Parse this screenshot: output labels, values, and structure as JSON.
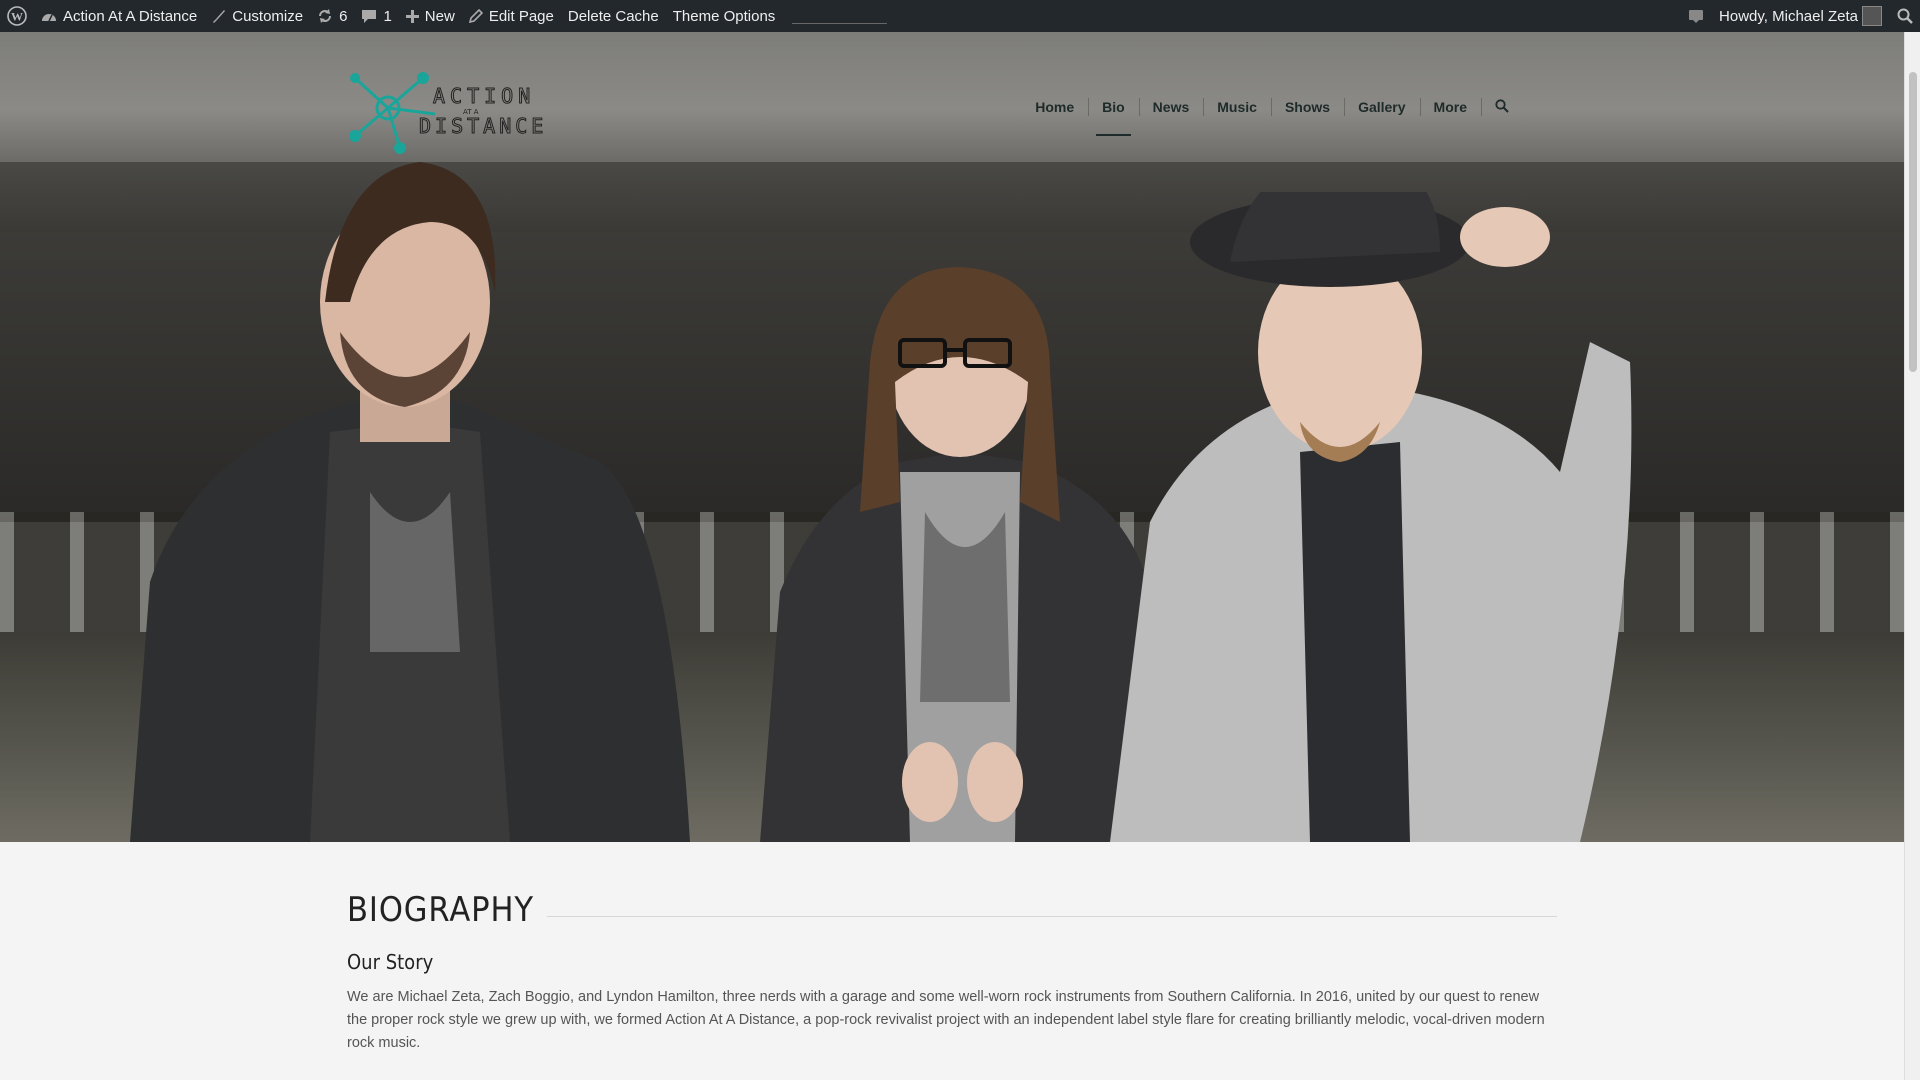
{
  "admin_bar": {
    "site_name": "Action At A Distance",
    "customize": "Customize",
    "updates_count": "6",
    "comments_count": "1",
    "new": "New",
    "edit_page": "Edit Page",
    "delete_cache": "Delete Cache",
    "theme_options": "Theme Options",
    "howdy": "Howdy, Michael Zeta"
  },
  "header": {
    "logo_line1": "ACTION",
    "logo_line2": "DISTANCE",
    "logo_at": "AT A",
    "nav": [
      {
        "label": "Home"
      },
      {
        "label": "Bio",
        "active": true
      },
      {
        "label": "News"
      },
      {
        "label": "Music"
      },
      {
        "label": "Shows"
      },
      {
        "label": "Gallery"
      },
      {
        "label": "More"
      }
    ]
  },
  "content": {
    "heading": "BIOGRAPHY",
    "subheading": "Our Story",
    "paragraph": "We are Michael Zeta, Zach Boggio, and Lyndon Hamilton, three nerds with a garage and some well-worn rock instruments from Southern California. In 2016, united by our quest to renew the proper rock style we grew up with, we formed Action At A Distance, a pop-rock revivalist project with an independent label style flare for creating brilliantly melodic, vocal-driven modern rock music."
  },
  "colors": {
    "admin_bar_bg": "#23282d",
    "logo_accent": "#1aa59a",
    "nav_text": "#1e2b2a",
    "page_bg": "#f4f4f4"
  }
}
